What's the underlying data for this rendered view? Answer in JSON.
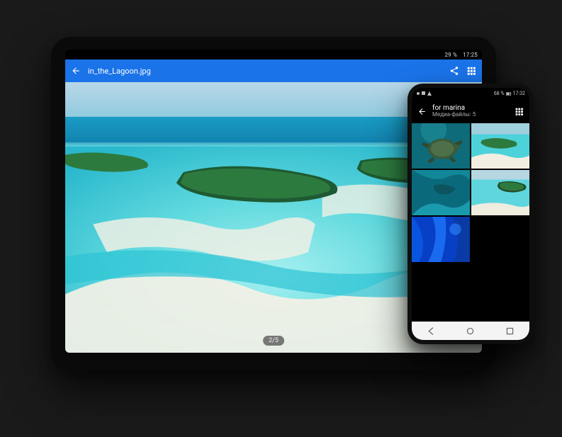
{
  "tablet": {
    "statusbar": {
      "left_icons": [
        "flipboard-icon",
        "play-store-icon",
        "more-icon"
      ],
      "battery_text": "29 %",
      "time": "17:25"
    },
    "appbar": {
      "title": "in_the_Lagoon.jpg"
    },
    "page_indicator": "2/5"
  },
  "phone": {
    "statusbar": {
      "battery_text": "68 %",
      "time": "17:32"
    },
    "appbar": {
      "title": "for marina",
      "subtitle": "Медиа-файлы: 5"
    },
    "thumbnails": [
      {
        "name": "turtle"
      },
      {
        "name": "lagoon-islands"
      },
      {
        "name": "aerial-reef"
      },
      {
        "name": "island-shore"
      },
      {
        "name": "blue-abstract"
      }
    ]
  }
}
